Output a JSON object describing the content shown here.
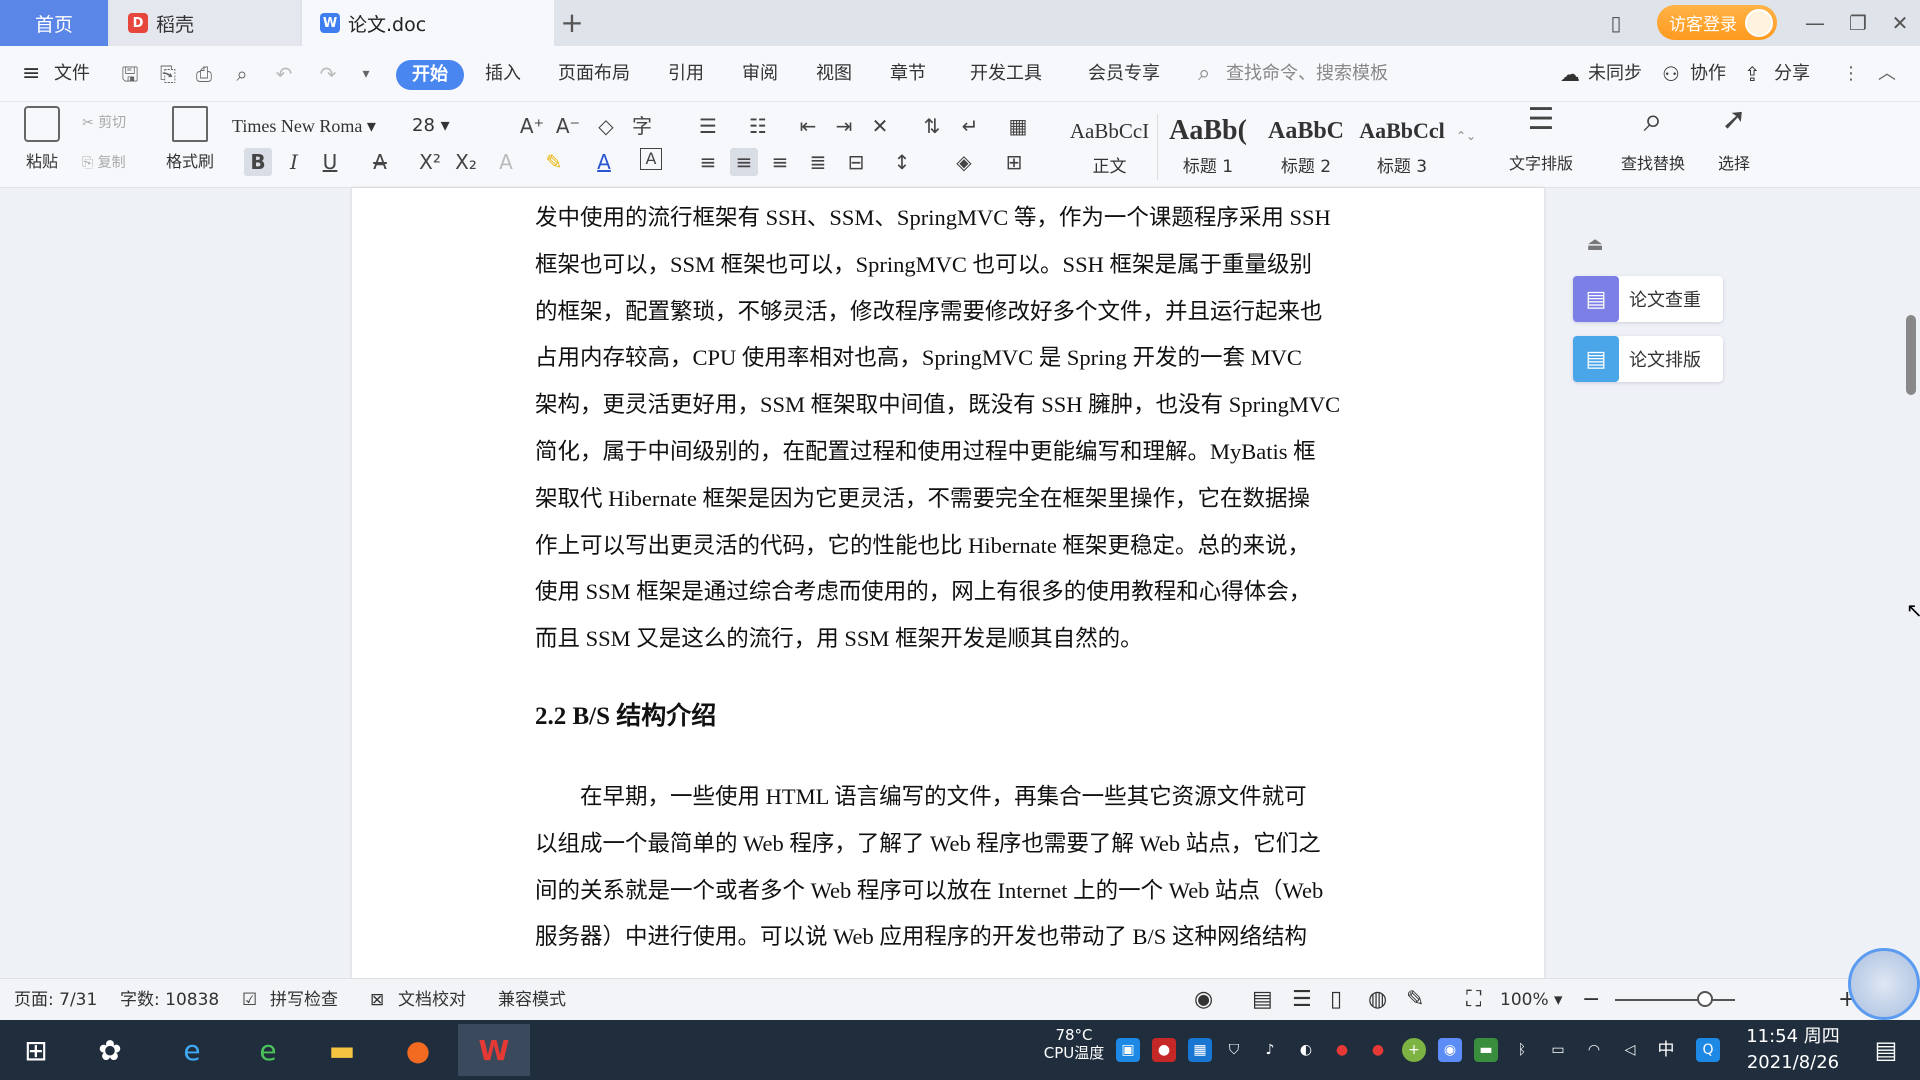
{
  "tabs": {
    "home": "首页",
    "daoke": "稻壳",
    "doc": "论文.doc",
    "add": "+"
  },
  "titlebar": {
    "login": "访客登录"
  },
  "menu": {
    "file": "文件",
    "items": [
      "开始",
      "插入",
      "页面布局",
      "引用",
      "审阅",
      "视图",
      "章节",
      "开发工具",
      "会员专享"
    ],
    "search_placeholder": "查找命令、搜索模板",
    "sync": "未同步",
    "collab": "协作",
    "share": "分享"
  },
  "ribbon": {
    "paste": "粘贴",
    "cut": "剪切",
    "copy": "复制",
    "format_painter": "格式刷",
    "font_name": "Times New Roma",
    "font_size": "28",
    "styles": [
      {
        "sample": "AaBbCcI",
        "name": "正文"
      },
      {
        "sample": "AaBb(",
        "name": "标题 1"
      },
      {
        "sample": "AaBbC",
        "name": "标题 2"
      },
      {
        "sample": "AaBbCcl",
        "name": "标题 3"
      }
    ],
    "text_layout": "文字排版",
    "find_replace": "查找替换",
    "select": "选择"
  },
  "document": {
    "paragraph1": [
      "发中使用的流行框架有 SSH、SSM、SpringMVC 等，作为一个课题程序采用 SSH",
      "框架也可以，SSM 框架也可以，SpringMVC 也可以。SSH 框架是属于重量级别",
      "的框架，配置繁琐，不够灵活，修改程序需要修改好多个文件，并且运行起来也",
      "占用内存较高，CPU 使用率相对也高，SpringMVC 是 Spring 开发的一套 MVC",
      "架构，更灵活更好用，SSM 框架取中间值，既没有 SSH 臃肿，也没有 SpringMVC",
      "简化，属于中间级别的，在配置过程和使用过程中更能编写和理解。MyBatis 框",
      "架取代 Hibernate 框架是因为它更灵活，不需要完全在框架里操作，它在数据操",
      "作上可以写出更灵活的代码，它的性能也比 Hibernate 框架更稳定。总的来说，",
      "使用 SSM 框架是通过综合考虑而使用的，网上有很多的使用教程和心得体会，",
      "而且 SSM 又是这么的流行，用 SSM 框架开发是顺其自然的。"
    ],
    "heading": "2.2 B/S 结构介绍",
    "paragraph2": [
      "在早期，一些使用 HTML 语言编写的文件，再集合一些其它资源文件就可",
      "以组成一个最简单的 Web 程序，了解了 Web 程序也需要了解 Web 站点，它们之",
      "间的关系就是一个或者多个 Web 程序可以放在 Internet 上的一个 Web 站点（Web",
      "服务器）中进行使用。可以说 Web 应用程序的开发也带动了 B/S 这种网络结构"
    ]
  },
  "side_panel": {
    "check": "论文查重",
    "format": "论文排版"
  },
  "status": {
    "page": "页面: 7/31",
    "words": "字数: 10838",
    "spell": "拼写检查",
    "proof": "文档校对",
    "compat": "兼容模式",
    "zoom": "100%",
    "zoom_level": 0.75
  },
  "taskbar": {
    "cpu_temp": "78°C",
    "cpu_label": "CPU温度",
    "ime": "中",
    "time": "11:54 周四",
    "date": "2021/8/26"
  },
  "colors": {
    "accent": "#4a86f0",
    "login": "#ff9a1f",
    "taskbar": "#1f2d3d"
  }
}
